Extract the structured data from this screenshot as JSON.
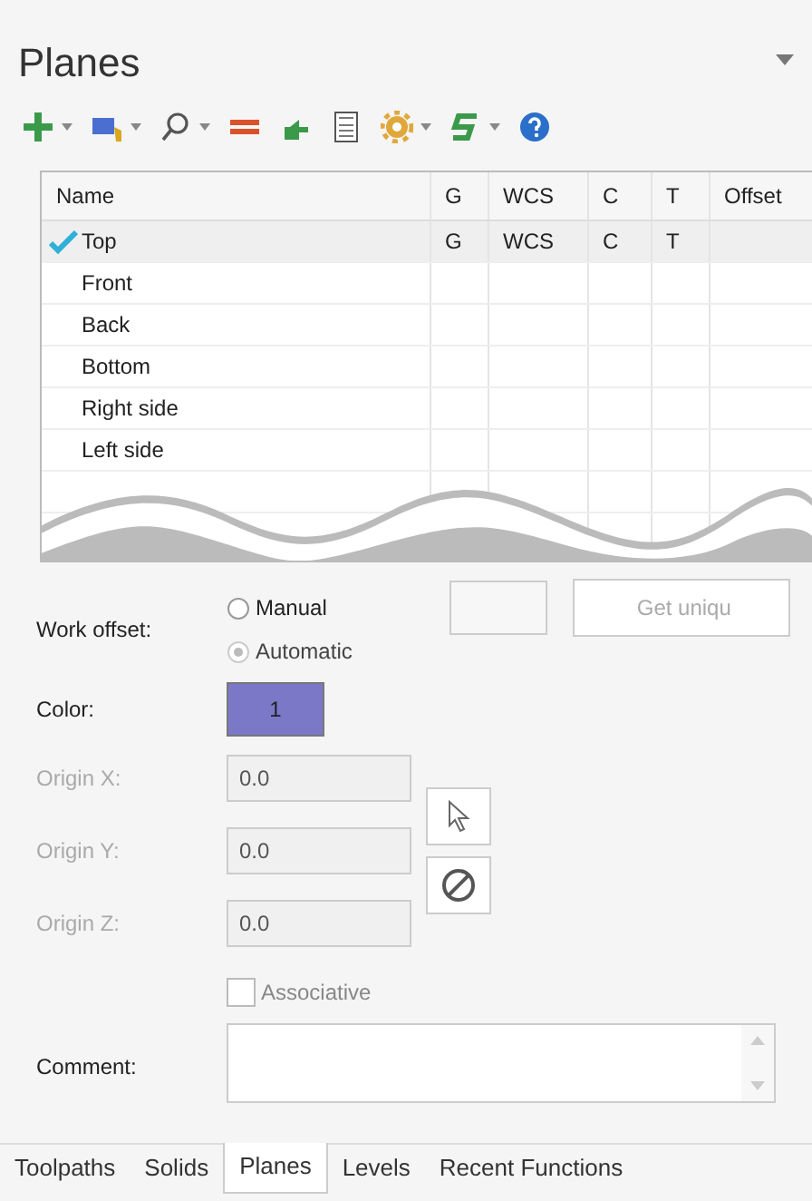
{
  "panel": {
    "title": "Planes"
  },
  "table": {
    "columns": [
      "Name",
      "G",
      "WCS",
      "C",
      "T",
      "Offset"
    ],
    "rows": [
      {
        "name": "Top",
        "active": true,
        "selected": true,
        "flags": [
          "G",
          "WCS",
          "C",
          "T"
        ]
      },
      {
        "name": "Front",
        "active": false,
        "selected": false
      },
      {
        "name": "Back",
        "active": false,
        "selected": false
      },
      {
        "name": "Bottom",
        "active": false,
        "selected": false
      },
      {
        "name": "Right side",
        "active": false,
        "selected": false
      },
      {
        "name": "Left side",
        "active": false,
        "selected": false
      }
    ]
  },
  "work_offset": {
    "label": "Work offset:",
    "options": [
      {
        "label": "Manual",
        "selected": false,
        "disabled": false
      },
      {
        "label": "Automatic",
        "selected": true,
        "disabled": true
      }
    ],
    "button": {
      "label": "Get uniqu",
      "disabled": true
    }
  },
  "color": {
    "label": "Color:",
    "value": "1",
    "color": "#7b78c8"
  },
  "origins": {
    "disabled": true,
    "items": [
      {
        "label": "Origin X:",
        "value": "0.0"
      },
      {
        "label": "Origin Y:",
        "value": "0.0"
      },
      {
        "label": "Origin Z:",
        "value": "0.0"
      }
    ]
  },
  "associative": {
    "label": "Associative",
    "checked": false
  },
  "comment": {
    "label": "Comment:"
  },
  "tabs": [
    {
      "label": "Toolpaths",
      "selected": false
    },
    {
      "label": "Solids",
      "selected": false
    },
    {
      "label": "Planes",
      "selected": true
    },
    {
      "label": "Levels",
      "selected": false
    },
    {
      "label": "Recent Functions",
      "selected": false
    }
  ]
}
